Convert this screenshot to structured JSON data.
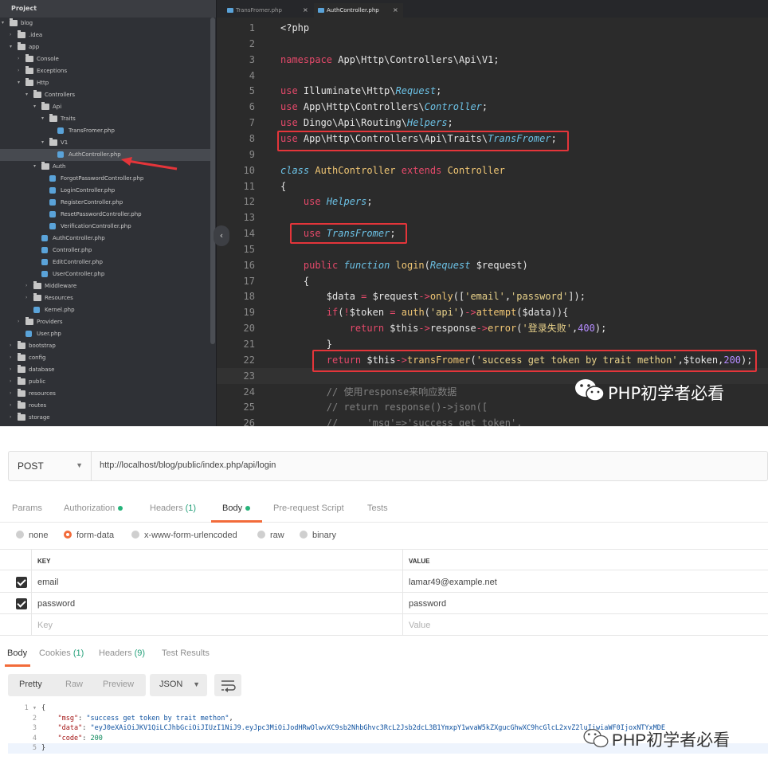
{
  "editor": {
    "project_title": "Project",
    "tabs": [
      {
        "label": "TransFromer.php",
        "close": "×"
      },
      {
        "label": "AuthController.php",
        "close": "×"
      }
    ],
    "collapse_glyph": "‹",
    "tree": [
      {
        "label": "blog",
        "type": "folder",
        "arrow": "▾"
      },
      {
        "label": ".idea",
        "type": "folder",
        "arrow": "›"
      },
      {
        "label": "app",
        "type": "folder",
        "arrow": "▾"
      },
      {
        "label": "Console",
        "type": "folder",
        "arrow": "›"
      },
      {
        "label": "Exceptions",
        "type": "folder",
        "arrow": "›"
      },
      {
        "label": "Http",
        "type": "folder",
        "arrow": "▾"
      },
      {
        "label": "Controllers",
        "type": "folder",
        "arrow": "▾"
      },
      {
        "label": "Api",
        "type": "folder",
        "arrow": "▾"
      },
      {
        "label": "Traits",
        "type": "folder",
        "arrow": "▾"
      },
      {
        "label": "TransFromer.php",
        "type": "file"
      },
      {
        "label": "V1",
        "type": "folder",
        "arrow": "▾"
      },
      {
        "label": "AuthController.php",
        "type": "file",
        "selected": true
      },
      {
        "label": "Auth",
        "type": "folder",
        "arrow": "▾"
      },
      {
        "label": "ForgotPasswordController.php",
        "type": "file"
      },
      {
        "label": "LoginController.php",
        "type": "file"
      },
      {
        "label": "RegisterController.php",
        "type": "file"
      },
      {
        "label": "ResetPasswordController.php",
        "type": "file"
      },
      {
        "label": "VerificationController.php",
        "type": "file"
      },
      {
        "label": "AuthController.php",
        "type": "file"
      },
      {
        "label": "Controller.php",
        "type": "file"
      },
      {
        "label": "EditController.php",
        "type": "file"
      },
      {
        "label": "UserController.php",
        "type": "file"
      },
      {
        "label": "Middleware",
        "type": "folder",
        "arrow": "›"
      },
      {
        "label": "Resources",
        "type": "folder",
        "arrow": "›"
      },
      {
        "label": "Kernel.php",
        "type": "file"
      },
      {
        "label": "Providers",
        "type": "folder",
        "arrow": "›"
      },
      {
        "label": "User.php",
        "type": "file"
      },
      {
        "label": "bootstrap",
        "type": "folder",
        "arrow": "›"
      },
      {
        "label": "config",
        "type": "folder",
        "arrow": "›"
      },
      {
        "label": "database",
        "type": "folder",
        "arrow": "›"
      },
      {
        "label": "public",
        "type": "folder",
        "arrow": "›"
      },
      {
        "label": "resources",
        "type": "folder",
        "arrow": "›"
      },
      {
        "label": "routes",
        "type": "folder",
        "arrow": "›"
      },
      {
        "label": "storage",
        "type": "folder",
        "arrow": "›"
      }
    ],
    "code_lines": [
      {
        "n": "1",
        "tokens": [
          [
            "",
            "<?php"
          ]
        ]
      },
      {
        "n": "2",
        "tokens": []
      },
      {
        "n": "3",
        "tokens": [
          [
            "kw",
            "namespace"
          ],
          [
            "",
            " App\\Http\\Controllers\\Api\\V1;"
          ]
        ]
      },
      {
        "n": "4",
        "tokens": []
      },
      {
        "n": "5",
        "tokens": [
          [
            "kw",
            "use"
          ],
          [
            "",
            " Illuminate\\Http\\"
          ],
          [
            "cls",
            "Request"
          ],
          [
            "",
            ";"
          ]
        ]
      },
      {
        "n": "6",
        "tokens": [
          [
            "kw",
            "use"
          ],
          [
            "",
            " App\\Http\\Controllers\\"
          ],
          [
            "cls",
            "Controller"
          ],
          [
            "",
            ";"
          ]
        ]
      },
      {
        "n": "7",
        "tokens": [
          [
            "kw",
            "use"
          ],
          [
            "",
            " Dingo\\Api\\Routing\\"
          ],
          [
            "cls",
            "Helpers"
          ],
          [
            "",
            ";"
          ]
        ]
      },
      {
        "n": "8",
        "tokens": [
          [
            "kw",
            "use"
          ],
          [
            "",
            " App\\Http\\Controllers\\Api\\Traits\\"
          ],
          [
            "cls",
            "TransFromer"
          ],
          [
            "",
            ";"
          ]
        ]
      },
      {
        "n": "9",
        "tokens": []
      },
      {
        "n": "10",
        "tokens": [
          [
            "cls",
            "class"
          ],
          [
            "",
            " "
          ],
          [
            "fn",
            "AuthController"
          ],
          [
            "",
            " "
          ],
          [
            "kw",
            "extends"
          ],
          [
            "",
            " "
          ],
          [
            "fn",
            "Controller"
          ]
        ]
      },
      {
        "n": "11",
        "tokens": [
          [
            "",
            "{"
          ]
        ]
      },
      {
        "n": "12",
        "tokens": [
          [
            "",
            "    "
          ],
          [
            "kw",
            "use"
          ],
          [
            "",
            " "
          ],
          [
            "cls",
            "Helpers"
          ],
          [
            "",
            ";"
          ]
        ]
      },
      {
        "n": "13",
        "tokens": []
      },
      {
        "n": "14",
        "tokens": [
          [
            "",
            "    "
          ],
          [
            "kw",
            "use"
          ],
          [
            "",
            " "
          ],
          [
            "cls",
            "TransFromer"
          ],
          [
            "",
            ";"
          ]
        ]
      },
      {
        "n": "15",
        "tokens": []
      },
      {
        "n": "16",
        "tokens": [
          [
            "",
            "    "
          ],
          [
            "kw",
            "public"
          ],
          [
            "",
            " "
          ],
          [
            "cls",
            "function"
          ],
          [
            "",
            " "
          ],
          [
            "fn",
            "login"
          ],
          [
            "",
            "("
          ],
          [
            "cls",
            "Request"
          ],
          [
            "",
            " $request)"
          ]
        ]
      },
      {
        "n": "17",
        "tokens": [
          [
            "",
            "    {"
          ]
        ]
      },
      {
        "n": "18",
        "tokens": [
          [
            "",
            "        $data "
          ],
          [
            "kw",
            "="
          ],
          [
            "",
            " $request"
          ],
          [
            "kw",
            "->"
          ],
          [
            "fn",
            "only"
          ],
          [
            "",
            "(["
          ],
          [
            "str",
            "'email'"
          ],
          [
            "",
            ","
          ],
          [
            "str",
            "'password'"
          ],
          [
            "",
            "]);"
          ]
        ]
      },
      {
        "n": "19",
        "tokens": [
          [
            "",
            "        "
          ],
          [
            "kw",
            "if"
          ],
          [
            "",
            "("
          ],
          [
            "kw",
            "!"
          ],
          [
            "",
            "$token "
          ],
          [
            "kw",
            "="
          ],
          [
            "",
            " "
          ],
          [
            "fn",
            "auth"
          ],
          [
            "",
            "("
          ],
          [
            "str",
            "'api'"
          ],
          [
            "",
            ")"
          ],
          [
            "kw",
            "->"
          ],
          [
            "fn",
            "attempt"
          ],
          [
            "",
            "($data)){"
          ]
        ]
      },
      {
        "n": "20",
        "tokens": [
          [
            "",
            "            "
          ],
          [
            "kw",
            "return"
          ],
          [
            "",
            " $this"
          ],
          [
            "kw",
            "->"
          ],
          [
            "",
            "response"
          ],
          [
            "kw",
            "->"
          ],
          [
            "fn",
            "error"
          ],
          [
            "",
            "("
          ],
          [
            "str",
            "'登录失败'"
          ],
          [
            "",
            ","
          ],
          [
            "num",
            "400"
          ],
          [
            "",
            ");"
          ]
        ]
      },
      {
        "n": "21",
        "tokens": [
          [
            "",
            "        }"
          ]
        ]
      },
      {
        "n": "22",
        "tokens": [
          [
            "",
            "        "
          ],
          [
            "kw",
            "return"
          ],
          [
            "",
            " $this"
          ],
          [
            "kw",
            "->"
          ],
          [
            "fn",
            "transFromer"
          ],
          [
            "",
            "("
          ],
          [
            "str",
            "'success get token by trait methon'"
          ],
          [
            "",
            ",$token,"
          ],
          [
            "num",
            "200"
          ],
          [
            "",
            ");"
          ]
        ]
      },
      {
        "n": "23",
        "tokens": [],
        "current": true
      },
      {
        "n": "24",
        "tokens": [
          [
            "cmt",
            "        // 使用response来响应数据"
          ]
        ]
      },
      {
        "n": "25",
        "tokens": [
          [
            "cmt",
            "        // return response()->json(["
          ]
        ]
      },
      {
        "n": "26",
        "tokens": [
          [
            "cmt",
            "        //     'msg'=>'success get token',"
          ]
        ]
      }
    ],
    "watermark": "PHP初学者必看"
  },
  "postman": {
    "method": "POST",
    "url": "http://localhost/blog/public/index.php/api/login",
    "request_tabs": [
      {
        "label": "Params"
      },
      {
        "label": "Authorization",
        "dot": true
      },
      {
        "label": "Headers",
        "count": "(1)"
      },
      {
        "label": "Body",
        "dot": true,
        "active": true
      },
      {
        "label": "Pre-request Script"
      },
      {
        "label": "Tests"
      }
    ],
    "body_types": [
      {
        "label": "none",
        "selected": false
      },
      {
        "label": "form-data",
        "selected": true
      },
      {
        "label": "x-www-form-urlencoded",
        "selected": false
      },
      {
        "label": "raw",
        "selected": false
      },
      {
        "label": "binary",
        "selected": false
      }
    ],
    "table": {
      "key_header": "KEY",
      "value_header": "VALUE",
      "rows": [
        {
          "key": "email",
          "value": "lamar49@example.net",
          "checked": true
        },
        {
          "key": "password",
          "value": "password",
          "checked": true
        }
      ],
      "placeholder_key": "Key",
      "placeholder_value": "Value"
    },
    "response_tabs": [
      {
        "label": "Body",
        "active": true
      },
      {
        "label": "Cookies",
        "count": "(1)"
      },
      {
        "label": "Headers",
        "count": "(9)"
      },
      {
        "label": "Test Results"
      }
    ],
    "view_modes": [
      "Pretty",
      "Raw",
      "Preview"
    ],
    "format": "JSON",
    "response_lines": [
      {
        "n": "1 ▾",
        "tokens": [
          [
            "",
            "{"
          ]
        ]
      },
      {
        "n": "2",
        "tokens": [
          [
            "",
            "    "
          ],
          [
            "jkey",
            "\"msg\""
          ],
          [
            "",
            ": "
          ],
          [
            "jstr",
            "\"success get token by trait methon\""
          ],
          [
            "",
            ","
          ]
        ]
      },
      {
        "n": "3",
        "tokens": [
          [
            "",
            "    "
          ],
          [
            "jkey",
            "\"data\""
          ],
          [
            "",
            ": "
          ],
          [
            "jstr",
            "\"eyJ0eXAiOiJKV1QiLCJhbGciOiJIUzI1NiJ9.eyJpc3MiOiJodHRwOlwvXC9sb2NhbGhvc3RcL2Jsb2dcL3B1YmxpY1wvaW5kZXgucGhwXC9hcGlcL2xvZ2luIiwiaWF0IjoxNTYxMDE"
          ]
        ]
      },
      {
        "n": "4",
        "tokens": [
          [
            "",
            "    "
          ],
          [
            "jkey",
            "\"code\""
          ],
          [
            "",
            ": "
          ],
          [
            "jnum",
            "200"
          ]
        ]
      },
      {
        "n": "5",
        "tokens": [
          [
            "",
            "}"
          ]
        ],
        "current": true
      }
    ],
    "watermark": "PHP初学者必看"
  }
}
